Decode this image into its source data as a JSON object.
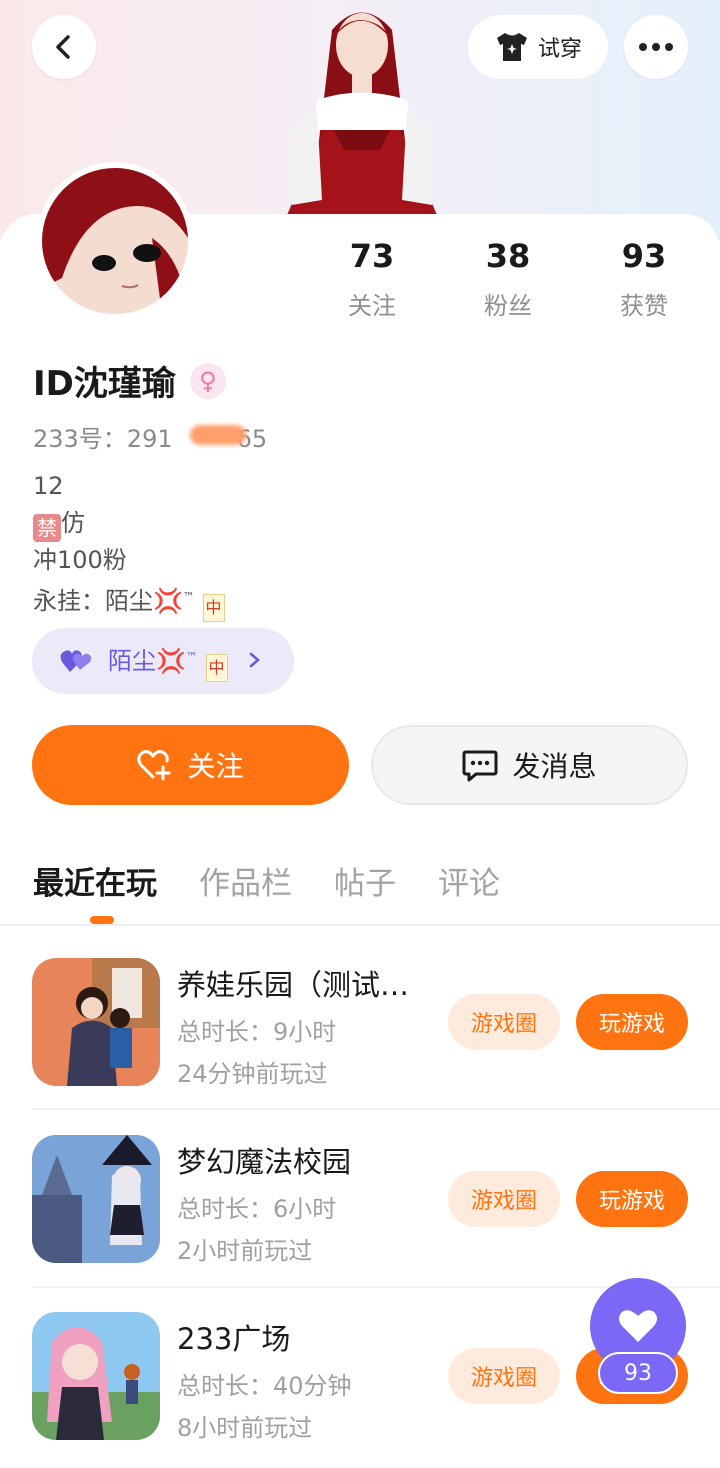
{
  "header": {
    "try_on_label": "试穿",
    "icons": [
      "back-icon",
      "tshirt-icon",
      "more-icon"
    ]
  },
  "stats": [
    {
      "value": "73",
      "label": "关注"
    },
    {
      "value": "38",
      "label": "粉丝"
    },
    {
      "value": "93",
      "label": "获赞"
    }
  ],
  "profile": {
    "name": "ID沈瑾瑜",
    "gender_symbol": "♀",
    "uid_prefix": "233号：291",
    "uid_suffix": "65",
    "bio_line1": "12",
    "bio_ban_char": "禁",
    "bio_line2_rest": "仿",
    "bio_line3": "冲100粉",
    "bio_line4_prefix": "永挂：陌尘",
    "bio_anger": "💢",
    "bio_tm": "™",
    "bio_mj": "中"
  },
  "family_pill": {
    "label": "陌尘",
    "anger": "💢",
    "tm": "™",
    "mj": "中"
  },
  "actions": {
    "follow_label": "关注",
    "message_label": "发消息"
  },
  "tabs": [
    {
      "label": "最近在玩",
      "active": true
    },
    {
      "label": "作品栏",
      "active": false
    },
    {
      "label": "帖子",
      "active": false
    },
    {
      "label": "评论",
      "active": false
    }
  ],
  "games": [
    {
      "title": "养娃乐园（测试…",
      "duration": "总时长：9小时",
      "last_played": "24分钟前玩过",
      "circle_label": "游戏圈",
      "play_label": "玩游戏"
    },
    {
      "title": "梦幻魔法校园",
      "duration": "总时长：6小时",
      "last_played": "2小时前玩过",
      "circle_label": "游戏圈",
      "play_label": "玩游戏"
    },
    {
      "title": "233广场",
      "duration": "总时长：40分钟",
      "last_played": "8小时前玩过",
      "circle_label": "游戏圈",
      "play_label": "玩游戏"
    }
  ],
  "like_fab": {
    "count": "93"
  },
  "colors": {
    "accent": "#ff7410",
    "purple": "#7b68f6",
    "pill_bg": "#eceaf9"
  }
}
